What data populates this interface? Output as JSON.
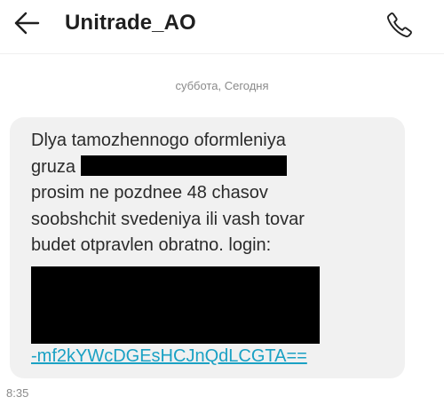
{
  "header": {
    "contact_name": "Unitrade_AO",
    "back_icon": "arrow-left-icon",
    "call_icon": "phone-icon"
  },
  "conversation": {
    "date_separator": "суббота, Сегодня",
    "message": {
      "lines": [
        "Dlya tamozhennogo oformleniya",
        "gruza",
        "prosim ne pozdnee 48 chasov",
        "soobshchit svedeniya ili vash tovar",
        "budet otpravlen obratno. login:"
      ],
      "link_text": "-mf2kYWcDGEsHCJnQdLCGTA==",
      "link_color": "#1aa1c4",
      "bubble_color": "#f1f1f1",
      "redaction_color": "#000000"
    },
    "timestamp": "8:35"
  }
}
